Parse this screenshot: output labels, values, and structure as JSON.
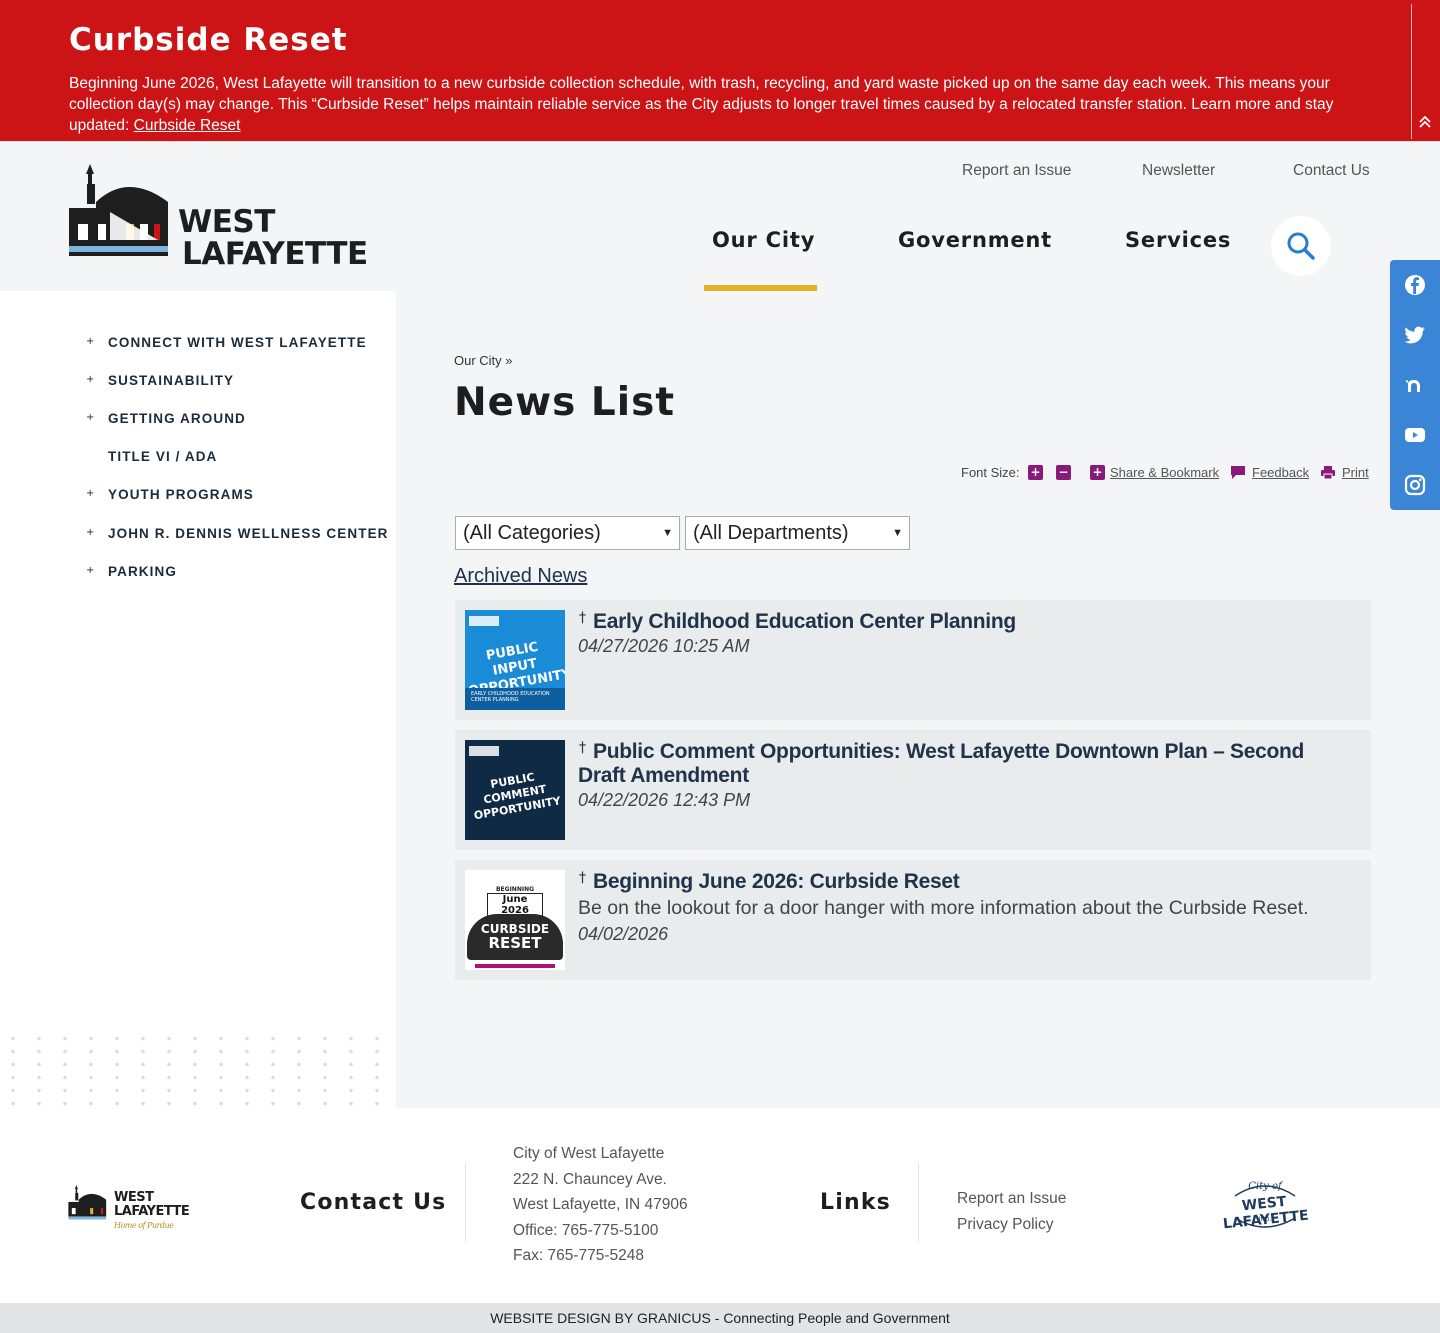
{
  "alert": {
    "title": "Curbside Reset",
    "text": "Beginning June 2026, West Lafayette will transition to a new curbside collection schedule, with trash, recycling, and yard waste picked up on the same day each week. This means your collection day(s) may change. This “Curbside Reset” helps maintain reliable service as the City adjusts to longer travel times caused by a relocated transfer station. Learn more and stay updated: ",
    "link": "Curbside Reset",
    "toggle_icon": "double-chevron-up-icon"
  },
  "header": {
    "logo_line1": "WEST",
    "logo_line2": "LAFAYETTE",
    "utility": [
      "Report an Issue",
      "Newsletter",
      "Contact Us"
    ],
    "nav": [
      "Our City",
      "Government",
      "Services"
    ],
    "active_nav_color": "#e1b229",
    "search_icon": "search-icon"
  },
  "social": [
    "facebook-icon",
    "twitter-icon",
    "nextdoor-icon",
    "youtube-icon",
    "instagram-icon"
  ],
  "sidebar": {
    "items": [
      {
        "label": "CONNECT WITH WEST LAFAYETTE",
        "bullet": true
      },
      {
        "label": "SUSTAINABILITY",
        "bullet": true
      },
      {
        "label": "GETTING AROUND",
        "bullet": true
      },
      {
        "label": "TITLE VI / ADA",
        "bullet": false
      },
      {
        "label": "YOUTH PROGRAMS",
        "bullet": true
      },
      {
        "label": "JOHN R. DENNIS WELLNESS CENTER",
        "bullet": true
      },
      {
        "label": "PARKING",
        "bullet": true
      }
    ],
    "bullet_char": "+"
  },
  "main": {
    "breadcrumb": "Our City »",
    "title": "News List",
    "font_size_label": "Font Size:",
    "font_plus": "+",
    "font_minus": "−",
    "share": "Share & Bookmark",
    "feedback": "Feedback",
    "print": "Print",
    "category_select": "(All Categories)",
    "department_select": "(All Departments)",
    "archived": "Archived News",
    "pin_char": "†",
    "news": [
      {
        "title": "Early Childhood Education Center Planning",
        "date": "04/27/2026 10:25 AM",
        "desc": "",
        "thumb_l1": "PUBLIC INPUT",
        "thumb_l2": "OPPORTUNITY",
        "thumb_sub": "EARLY CHILDHOOD EDUCATION CENTER PLANNING"
      },
      {
        "title": "Public Comment Opportunities: West Lafayette Downtown Plan – Second Draft Amendment",
        "date": "04/22/2026 12:43 PM",
        "desc": "",
        "thumb_l1": "PUBLIC COMMENT",
        "thumb_l2": "OPPORTUNITY",
        "thumb_sub": ""
      },
      {
        "title": "Beginning June 2026: Curbside Reset",
        "date": "04/02/2026",
        "desc": "Be on the lookout for a door hanger with more information about the Curbside Reset.",
        "thumb_l1": "June 2026",
        "thumb_l2": "CURBSIDE",
        "thumb_l3": "RESET",
        "thumb_top": "BEGINNING"
      }
    ]
  },
  "footer": {
    "logo_line1": "WEST",
    "logo_line2": "LAFAYETTE",
    "logo_tag": "Home of Purdue",
    "contact_heading": "Contact Us",
    "address": [
      "City of West Lafayette",
      "222 N. Chauncey Ave.",
      "West Lafayette, IN 47906",
      "Office: 765-775-5100",
      "Fax: 765-775-5248"
    ],
    "links_heading": "Links",
    "links": [
      "Report an Issue",
      "Privacy Policy"
    ],
    "seal_top": "City of",
    "seal_main": "WEST LAFAYETTE",
    "seal_bottom": "IND.",
    "credit": "WEBSITE DESIGN BY GRANICUS - Connecting People and Government"
  }
}
